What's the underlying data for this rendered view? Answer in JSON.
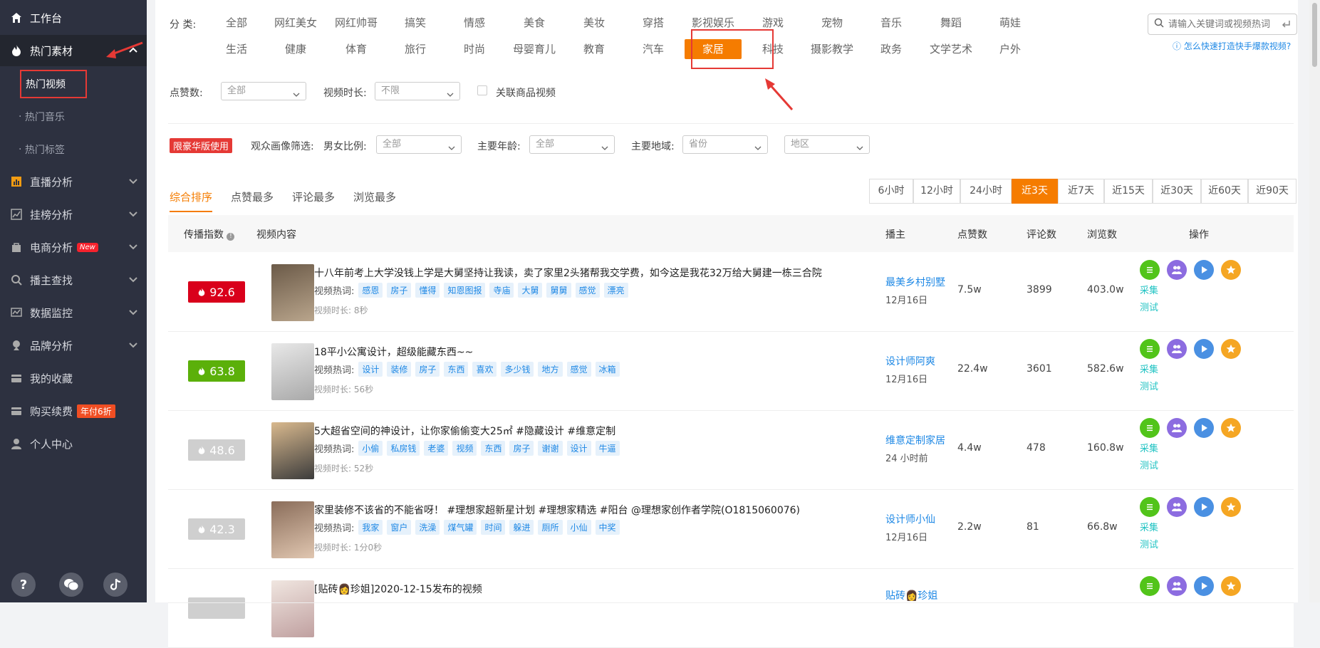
{
  "sidebar": {
    "workbench": "工作台",
    "hot_material": "热门素材",
    "subs": [
      "热门视频",
      "热门音乐",
      "热门标签"
    ],
    "items": [
      {
        "label": "直播分析",
        "icon": "bar-chart-icon"
      },
      {
        "label": "挂榜分析",
        "icon": "line-chart-icon"
      },
      {
        "label": "电商分析",
        "icon": "shop-icon",
        "badge": "New"
      },
      {
        "label": "播主查找",
        "icon": "search-icon"
      },
      {
        "label": "数据监控",
        "icon": "monitor-icon"
      },
      {
        "label": "品牌分析",
        "icon": "brand-icon"
      },
      {
        "label": "我的收藏",
        "icon": "collection-icon"
      },
      {
        "label": "购买续费",
        "icon": "card-icon",
        "badge": "年付6折"
      },
      {
        "label": "个人中心",
        "icon": "user-icon"
      }
    ],
    "bottom_icons": [
      "help-icon",
      "wechat-icon",
      "tiktok-icon"
    ]
  },
  "category": {
    "label": "分  类:",
    "row1": [
      "全部",
      "网红美女",
      "网红帅哥",
      "搞笑",
      "情感",
      "美食",
      "美妆",
      "穿搭",
      "影视娱乐",
      "游戏",
      "宠物",
      "音乐",
      "舞蹈",
      "萌娃"
    ],
    "row2": [
      "生活",
      "健康",
      "体育",
      "旅行",
      "时尚",
      "母婴育儿",
      "教育",
      "汽车",
      "家居",
      "科技",
      "摄影教学",
      "政务",
      "文学艺术",
      "户外"
    ],
    "active": "家居"
  },
  "search": {
    "placeholder": "请输入关键词或视频热词",
    "help": "怎么快速打造快手爆款视频?"
  },
  "filters": {
    "likes_label": "点赞数:",
    "likes_value": "全部",
    "duration_label": "视频时长:",
    "duration_value": "不限",
    "product_label": "关联商品视频",
    "lux_badge": "限豪华版使用",
    "audience_label": "观众画像筛选:",
    "gender_label": "男女比例:",
    "gender_value": "全部",
    "age_label": "主要年龄:",
    "age_value": "全部",
    "region_label": "主要地域:",
    "province": "省份",
    "area": "地区"
  },
  "sort_tabs": [
    "综合排序",
    "点赞最多",
    "评论最多",
    "浏览最多"
  ],
  "time_ranges": [
    "6小时",
    "12小时",
    "24小时",
    "近3天",
    "近7天",
    "近15天",
    "近30天",
    "近60天",
    "近90天"
  ],
  "time_active": "近3天",
  "table": {
    "headers": [
      "传播指数",
      "视频内容",
      "播主",
      "点赞数",
      "评论数",
      "浏览数",
      "操作"
    ],
    "hot_words_label": "视频热词:",
    "dur_label": "视频时长:",
    "collect": "采集",
    "test": "测试",
    "rows": [
      {
        "score": "92.6",
        "color": "#d9001b",
        "title": "十八年前考上大学没钱上学是大舅坚持让我读，卖了家里2头猪帮我交学费，如今这是我花32万给大舅建一栋三合院",
        "tags": [
          "感恩",
          "房子",
          "懂得",
          "知恩图报",
          "寺庙",
          "大舅",
          "舅舅",
          "感觉",
          "漂亮"
        ],
        "duration": "8秒",
        "anchor": "最美乡村别墅",
        "date": "12月16日",
        "likes": "7.5w",
        "comments": "3899",
        "views": "403.0w"
      },
      {
        "score": "63.8",
        "color": "#5bb00a",
        "title": "18平小公寓设计，超级能藏东西~~",
        "tags": [
          "设计",
          "装修",
          "房子",
          "东西",
          "喜欢",
          "多少钱",
          "地方",
          "感觉",
          "冰箱"
        ],
        "duration": "56秒",
        "anchor": "设计师阿爽",
        "date": "12月16日",
        "likes": "22.4w",
        "comments": "3601",
        "views": "582.6w"
      },
      {
        "score": "48.6",
        "color": "#cfcfcf",
        "title": "5大超省空间的神设计，让你家偷偷变大25㎡ #隐藏设计 #维意定制",
        "tags": [
          "小偷",
          "私房钱",
          "老婆",
          "视频",
          "东西",
          "房子",
          "谢谢",
          "设计",
          "牛逼"
        ],
        "duration": "52秒",
        "anchor": "维意定制家居",
        "date": "24 小时前",
        "likes": "4.4w",
        "comments": "478",
        "views": "160.8w"
      },
      {
        "score": "42.3",
        "color": "#cfcfcf",
        "title": "家里装修不该省的不能省呀！ #理想家超新星计划 #理想家精选 #阳台 @理想家创作者学院(O1815060076)",
        "tags": [
          "我家",
          "窗户",
          "洗澡",
          "煤气罐",
          "时间",
          "躲进",
          "厕所",
          "小仙",
          "中奖"
        ],
        "duration": "1分0秒",
        "anchor": "设计师小仙",
        "date": "12月16日",
        "likes": "2.2w",
        "comments": "81",
        "views": "66.8w"
      },
      {
        "score": "",
        "color": "#cfcfcf",
        "title": "[贴砖👩珍姐]2020-12-15发布的视频",
        "tags": [],
        "duration": "",
        "anchor": "贴砖👩珍姐",
        "date": "",
        "likes": "",
        "comments": "",
        "views": ""
      }
    ]
  }
}
